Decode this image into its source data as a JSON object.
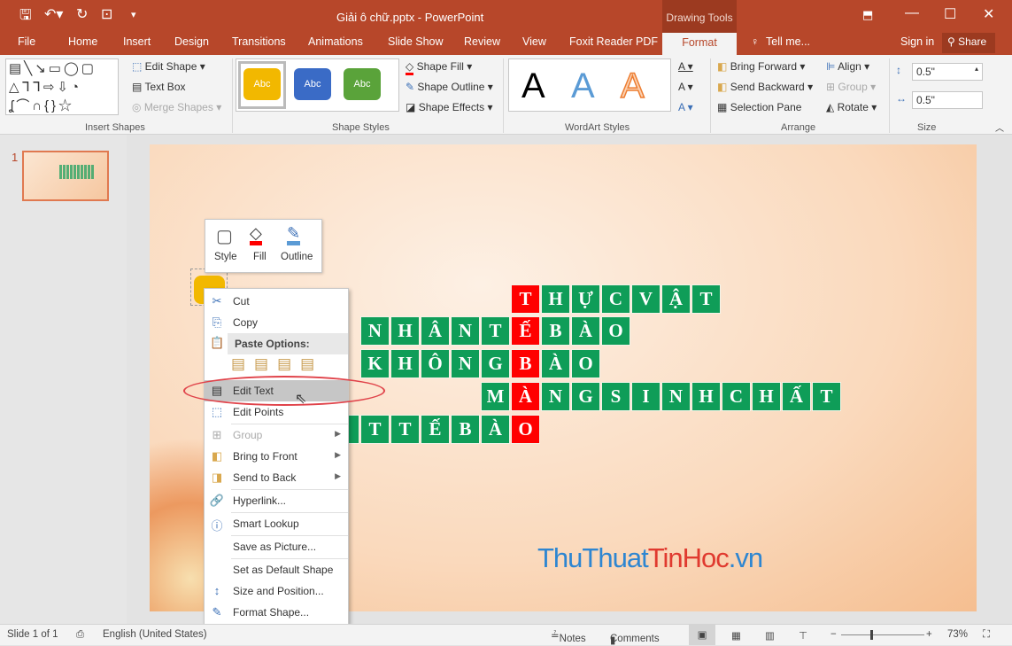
{
  "window": {
    "title": "Giải ô chữ.pptx - PowerPoint",
    "context_tab_group": "Drawing Tools"
  },
  "quick_access": {
    "save": "save-icon",
    "undo": "undo-icon",
    "redo": "redo-icon",
    "present": "present-icon",
    "customize": "customize-icon"
  },
  "tabs": [
    "File",
    "Home",
    "Insert",
    "Design",
    "Transitions",
    "Animations",
    "Slide Show",
    "Review",
    "View",
    "Foxit Reader PDF",
    "Format"
  ],
  "active_tab": "Format",
  "tell_me": "Tell me...",
  "sign_in": "Sign in",
  "share": "Share",
  "ribbon": {
    "insert_shapes": {
      "label": "Insert Shapes",
      "edit_shape": "Edit Shape",
      "text_box": "Text Box",
      "merge_shapes": "Merge Shapes"
    },
    "shape_styles": {
      "label": "Shape Styles",
      "swatches": [
        {
          "text": "Abc",
          "color": "#f2b800"
        },
        {
          "text": "Abc",
          "color": "#3a6bc6"
        },
        {
          "text": "Abc",
          "color": "#5aa33a"
        }
      ],
      "shape_fill": "Shape Fill",
      "shape_outline": "Shape Outline",
      "shape_effects": "Shape Effects"
    },
    "wordart_styles": {
      "label": "WordArt Styles",
      "letters": [
        "A",
        "A",
        "A"
      ]
    },
    "arrange": {
      "label": "Arrange",
      "bring_forward": "Bring Forward",
      "send_backward": "Send Backward",
      "selection_pane": "Selection Pane",
      "align": "Align",
      "group": "Group",
      "rotate": "Rotate"
    },
    "size": {
      "label": "Size",
      "height": "0.5\"",
      "width": "0.5\""
    }
  },
  "thumbnail": {
    "number": "1"
  },
  "puzzle": {
    "rows": [
      {
        "letters": [
          "T",
          "H",
          "Ự",
          "C",
          "V",
          "Ậ",
          "T"
        ],
        "key_index": 0
      },
      {
        "letters": [
          "N",
          "H",
          "Â",
          "N",
          "T",
          "Ế",
          "B",
          "À",
          "O"
        ],
        "key_index": 5
      },
      {
        "letters": [
          "K",
          "H",
          "Ô",
          "N",
          "G",
          "B",
          "À",
          "O"
        ],
        "key_index": 5
      },
      {
        "letters": [
          "M",
          "À",
          "N",
          "G",
          "S",
          "I",
          "N",
          "H",
          "C",
          "H",
          "Ấ",
          "T"
        ],
        "key_index": 1
      },
      {
        "letters": [
          "",
          "T",
          "T",
          "Ế",
          "B",
          "À",
          "O"
        ],
        "key_index": 6
      }
    ],
    "green": "#0f9d58",
    "red": "#ff0000"
  },
  "watermark": {
    "part1": "ThuThuat",
    "part2": "TinHoc",
    "part3": ".vn"
  },
  "mini_toolbar": {
    "style": "Style",
    "fill": "Fill",
    "outline": "Outline"
  },
  "context_menu": {
    "cut": "Cut",
    "copy": "Copy",
    "paste_options": "Paste Options:",
    "edit_text": "Edit Text",
    "edit_points": "Edit Points",
    "group": "Group",
    "bring_to_front": "Bring to Front",
    "send_to_back": "Send to Back",
    "hyperlink": "Hyperlink...",
    "smart_lookup": "Smart Lookup",
    "save_as_picture": "Save as Picture...",
    "set_default": "Set as Default Shape",
    "size_position": "Size and Position...",
    "format_shape": "Format Shape..."
  },
  "status": {
    "slide": "Slide 1 of 1",
    "language": "English (United States)",
    "notes": "Notes",
    "comments": "Comments",
    "zoom": "73%",
    "zoom_level": 73
  }
}
